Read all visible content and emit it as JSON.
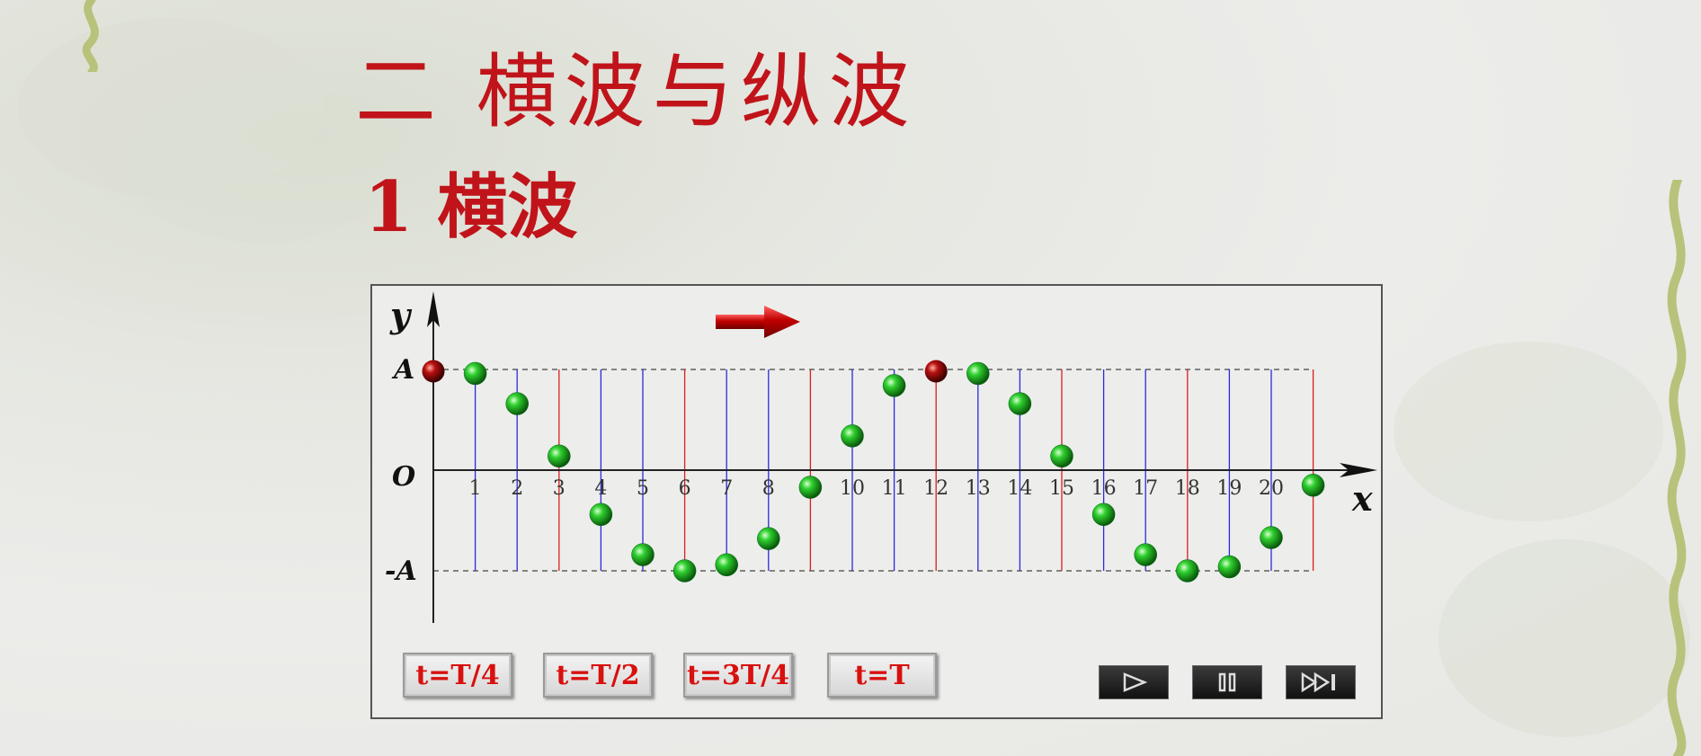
{
  "title": "二  横波与纵波",
  "subtitle": "1  横波",
  "diagram": {
    "axis_y_label": "y",
    "axis_x_label": "x",
    "label_A": "A",
    "label_O": "O",
    "label_negA": "-A",
    "tick_labels": [
      "1",
      "2",
      "3",
      "4",
      "5",
      "6",
      "7",
      "8",
      "",
      "10",
      "11",
      "12",
      "13",
      "14",
      "15",
      "16",
      "17",
      "18",
      "19",
      "20",
      ""
    ],
    "particle_values": [
      1.0,
      0.96,
      0.66,
      0.14,
      -0.44,
      -0.84,
      -1.0,
      -0.94,
      -0.68,
      -0.17,
      0.34,
      0.84,
      1.0,
      0.96,
      0.66,
      0.14,
      -0.44,
      -0.84,
      -1.0,
      -0.96,
      -0.67,
      -0.15
    ],
    "highlight_particles": [
      0,
      12
    ],
    "colors": {
      "particle": "#1aa31a",
      "highlight_particle": "#8a0c0c",
      "blue_line": "#2a2ae0",
      "red_line": "#d82020",
      "arrow": "#c01010",
      "title": "#c0141a"
    }
  },
  "buttons": [
    "t=T/4",
    "t=T/2",
    "t=3T/4",
    "t=T"
  ],
  "controls": [
    "play-icon",
    "pause-icon",
    "fast-forward-icon"
  ]
}
